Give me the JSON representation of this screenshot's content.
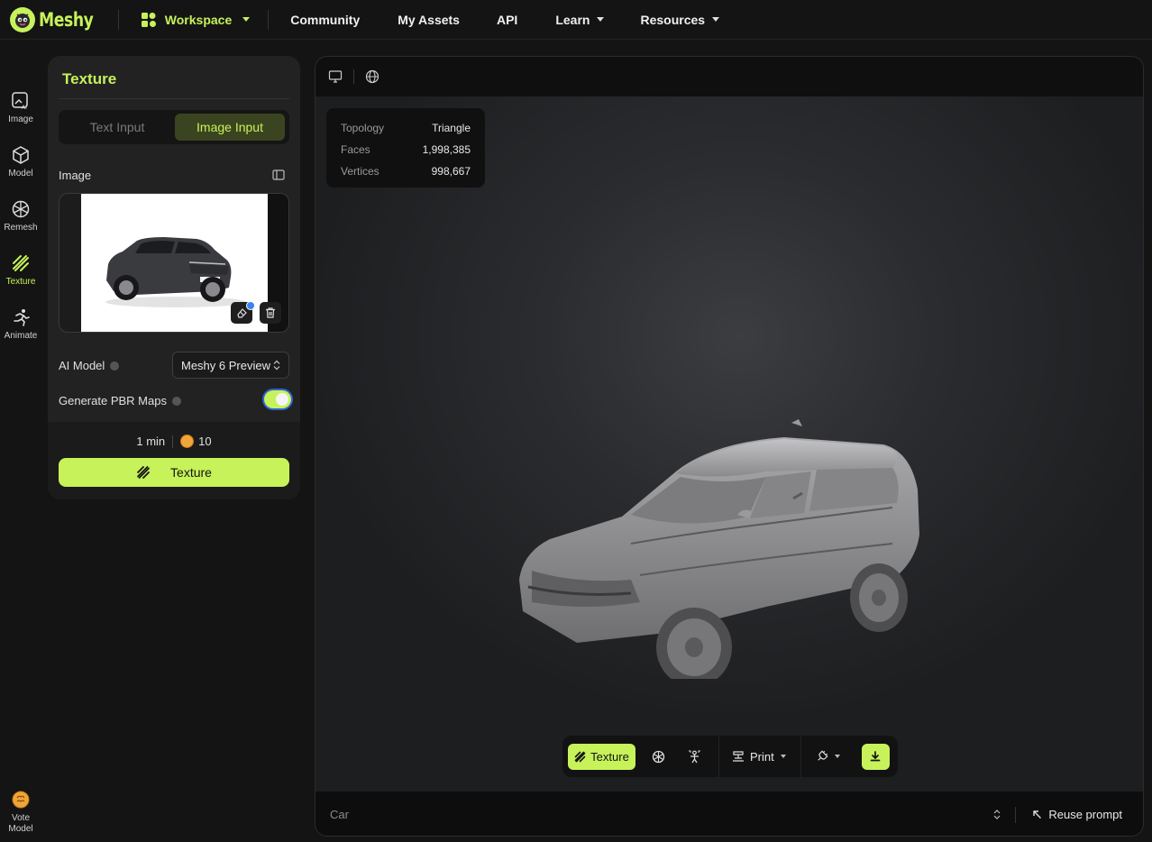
{
  "nav": {
    "logo": "Meshy",
    "items": [
      {
        "label": "Workspace",
        "dropdown": true
      },
      {
        "label": "Community",
        "dropdown": false
      },
      {
        "label": "My Assets",
        "dropdown": false
      },
      {
        "label": "API",
        "dropdown": false
      },
      {
        "label": "Learn",
        "dropdown": true
      },
      {
        "label": "Resources",
        "dropdown": true
      }
    ]
  },
  "rail": {
    "items": [
      {
        "label": "Image",
        "icon": "image-ai-icon",
        "active": false
      },
      {
        "label": "Model",
        "icon": "cube-icon",
        "active": false
      },
      {
        "label": "Remesh",
        "icon": "remesh-icon",
        "active": false
      },
      {
        "label": "Texture",
        "icon": "texture-icon",
        "active": true
      },
      {
        "label": "Animate",
        "icon": "running-figure-icon",
        "active": false
      }
    ],
    "vote_line1": "Vote",
    "vote_line2": "Model"
  },
  "panel": {
    "title": "Texture",
    "tabs": {
      "text": "Text Input",
      "image": "Image Input",
      "active": "image"
    },
    "image_label": "Image",
    "ai_model_label": "AI Model",
    "ai_model_value": "Meshy 6 Preview",
    "pbr_label": "Generate PBR Maps",
    "pbr_enabled": true,
    "time": "1 min",
    "credits": "10",
    "generate_label": "Texture"
  },
  "viewer": {
    "stats": [
      {
        "key": "Topology",
        "value": "Triangle"
      },
      {
        "key": "Faces",
        "value": "1,998,385"
      },
      {
        "key": "Vertices",
        "value": "998,667"
      }
    ],
    "toolbar": {
      "texture": "Texture",
      "print": "Print"
    },
    "prompt": "Car",
    "reuse": "Reuse prompt"
  },
  "colors": {
    "accent": "#c7f25a",
    "background": "#141414",
    "panel": "#222222"
  }
}
